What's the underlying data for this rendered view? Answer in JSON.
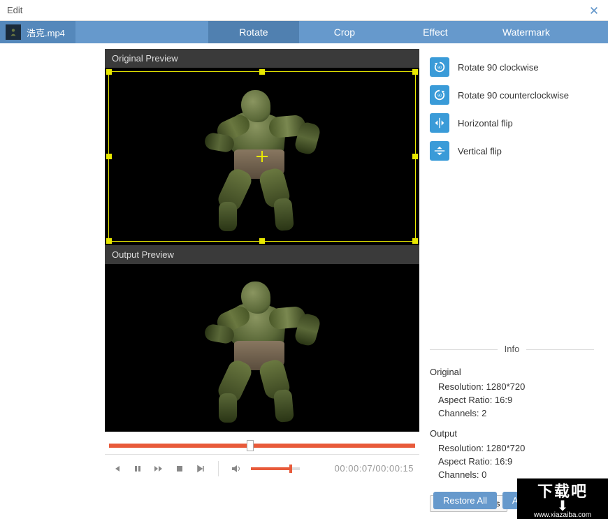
{
  "window": {
    "title": "Edit"
  },
  "file": {
    "name": "浩克.mp4"
  },
  "tabs": {
    "rotate": "Rotate",
    "crop": "Crop",
    "effect": "Effect",
    "watermark": "Watermark"
  },
  "preview": {
    "original_label": "Original Preview",
    "output_label": "Output Preview"
  },
  "rotate_options": {
    "cw": "Rotate 90 clockwise",
    "ccw": "Rotate 90 counterclockwise",
    "hflip": "Horizontal flip",
    "vflip": "Vertical flip"
  },
  "info": {
    "header": "Info",
    "original": {
      "title": "Original",
      "resolution": "Resolution: 1280*720",
      "aspect": "Aspect Ratio: 16:9",
      "channels": "Channels: 2"
    },
    "output": {
      "title": "Output",
      "resolution": "Resolution: 1280*720",
      "aspect": "Aspect Ratio: 16:9",
      "channels": "Channels: 0"
    }
  },
  "buttons": {
    "restore_defaults": "Restore Defaults",
    "restore_all": "Restore All",
    "apply": "A"
  },
  "playback": {
    "time": "00:00:07/00:00:15"
  },
  "watermark_overlay": {
    "text1": "下载吧",
    "text2": "www.xiazaiba.com"
  }
}
